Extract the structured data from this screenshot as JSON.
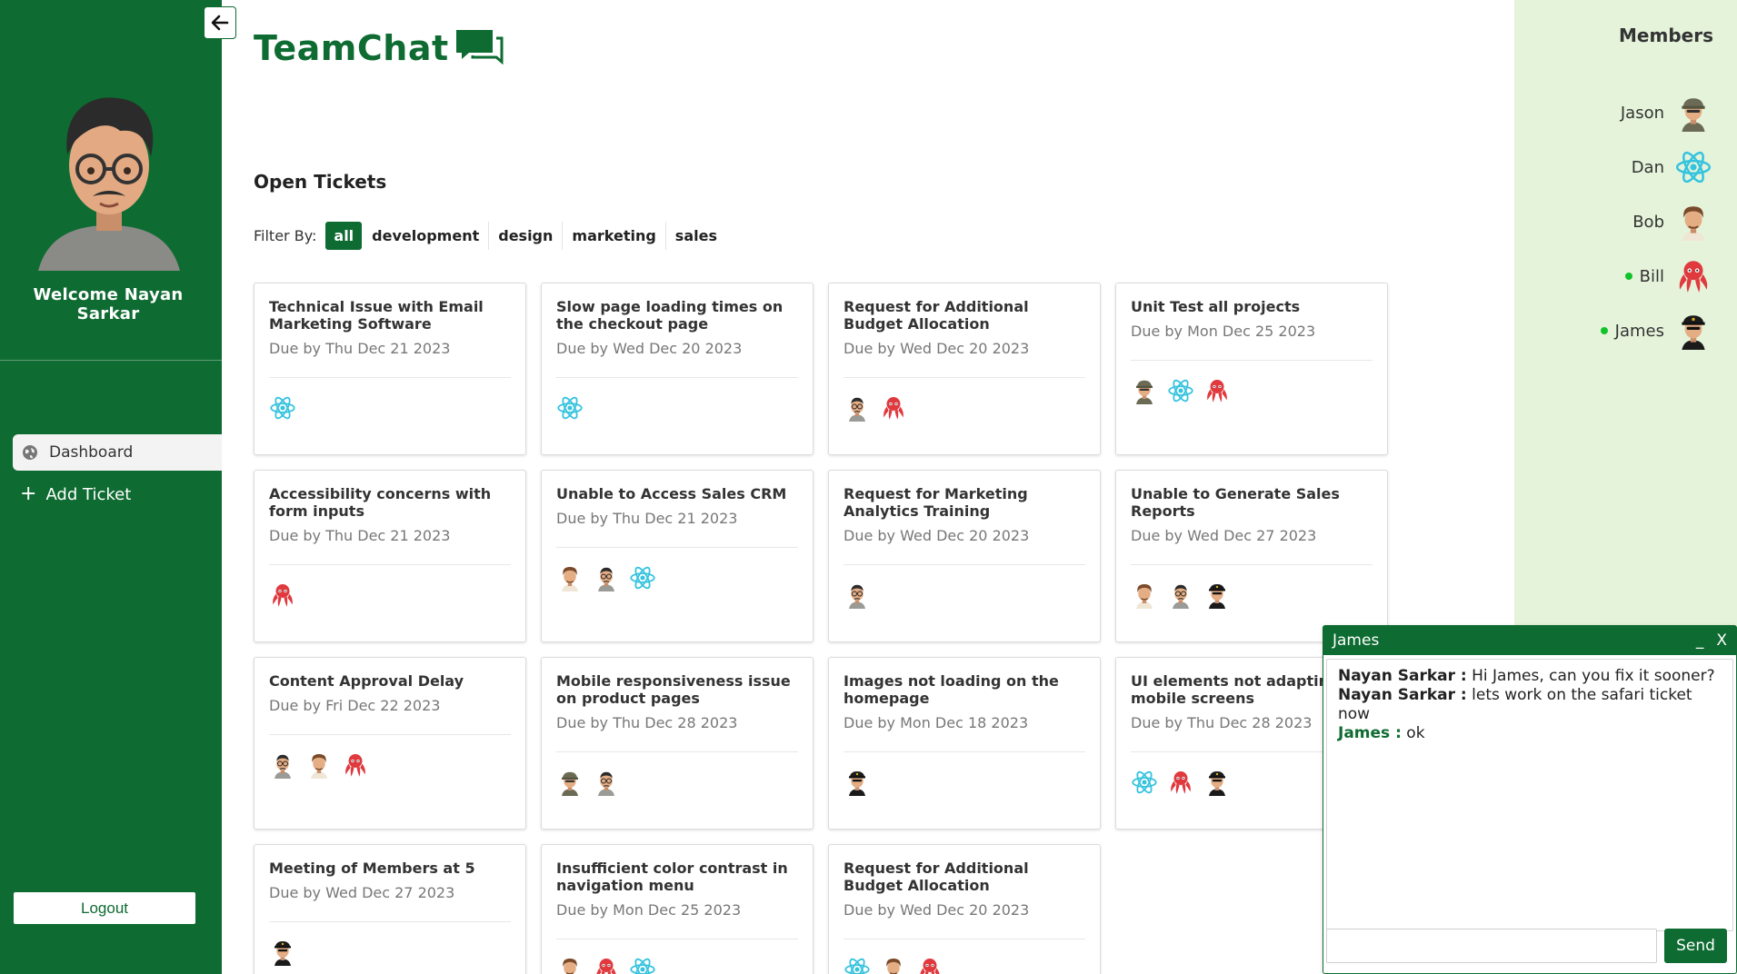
{
  "sidebar": {
    "welcome": "Welcome Nayan Sarkar",
    "nav": {
      "dashboard": "Dashboard",
      "add_ticket": "Add Ticket"
    },
    "logout": "Logout"
  },
  "brand": {
    "title": "TeamChat"
  },
  "main": {
    "section_title": "Open Tickets",
    "filter_label": "Filter By:",
    "filters": [
      "all",
      "development",
      "design",
      "marketing",
      "sales"
    ],
    "active_filter": "all"
  },
  "tickets": [
    {
      "title": "Technical Issue with Email Marketing Software",
      "due": "Due by Thu Dec 21 2023",
      "avatars": [
        "react"
      ]
    },
    {
      "title": "Slow page loading times on the checkout page",
      "due": "Due by Wed Dec 20 2023",
      "avatars": [
        "react"
      ]
    },
    {
      "title": "Request for Additional Budget Allocation",
      "due": "Due by Wed Dec 20 2023",
      "avatars": [
        "glasses",
        "octopus"
      ]
    },
    {
      "title": "Unit Test all projects",
      "due": "Due by Mon Dec 25 2023",
      "avatars": [
        "cap",
        "react",
        "octopus"
      ]
    },
    {
      "title": "Accessibility concerns with form inputs",
      "due": "Due by Thu Dec 21 2023",
      "avatars": [
        "octopus"
      ]
    },
    {
      "title": "Unable to Access Sales CRM",
      "due": "Due by Thu Dec 21 2023",
      "avatars": [
        "curly",
        "glasses",
        "react"
      ]
    },
    {
      "title": "Request for Marketing Analytics Training",
      "due": "Due by Wed Dec 20 2023",
      "avatars": [
        "glasses"
      ]
    },
    {
      "title": "Unable to Generate Sales Reports",
      "due": "Due by Wed Dec 27 2023",
      "avatars": [
        "curly",
        "glasses",
        "pilot"
      ]
    },
    {
      "title": "Content Approval Delay",
      "due": "Due by Fri Dec 22 2023",
      "avatars": [
        "glasses",
        "curly",
        "octopus"
      ]
    },
    {
      "title": "Mobile responsiveness issue on product pages",
      "due": "Due by Thu Dec 28 2023",
      "avatars": [
        "cap",
        "glasses"
      ]
    },
    {
      "title": "Images not loading on the homepage",
      "due": "Due by Mon Dec 18 2023",
      "avatars": [
        "pilot"
      ]
    },
    {
      "title": "UI elements not adapting to mobile screens",
      "due": "Due by Thu Dec 28 2023",
      "avatars": [
        "react",
        "octopus",
        "pilot"
      ]
    },
    {
      "title": "Meeting of Members at 5",
      "due": "Due by Wed Dec 27 2023",
      "avatars": [
        "pilot"
      ]
    },
    {
      "title": "Insufficient color contrast in navigation menu",
      "due": "Due by Mon Dec 25 2023",
      "avatars": [
        "curly",
        "octopus",
        "react"
      ]
    },
    {
      "title": "Request for Additional Budget Allocation",
      "due": "Due by Wed Dec 20 2023",
      "avatars": [
        "react",
        "curly",
        "octopus"
      ]
    }
  ],
  "members": {
    "title": "Members",
    "list": [
      {
        "name": "Jason",
        "online": false,
        "avatar": "cap"
      },
      {
        "name": "Dan",
        "online": false,
        "avatar": "react"
      },
      {
        "name": "Bob",
        "online": false,
        "avatar": "curly"
      },
      {
        "name": "Bill",
        "online": true,
        "avatar": "octopus"
      },
      {
        "name": "James",
        "online": true,
        "avatar": "pilot"
      }
    ]
  },
  "chat": {
    "recipient": "James",
    "minimize": "_",
    "close": "X",
    "messages": [
      {
        "sender": "Nayan Sarkar :",
        "text": " Hi James, can you fix it sooner?",
        "self": true
      },
      {
        "sender": "Nayan Sarkar :",
        "text": " lets work on the safari ticket now",
        "self": true
      },
      {
        "sender": "James :",
        "text": " ok",
        "self": false
      }
    ],
    "input_value": "",
    "send": "Send"
  },
  "colors": {
    "brand": "#0e6b31",
    "members_bg": "#e5f3da",
    "online": "#10c32a"
  }
}
